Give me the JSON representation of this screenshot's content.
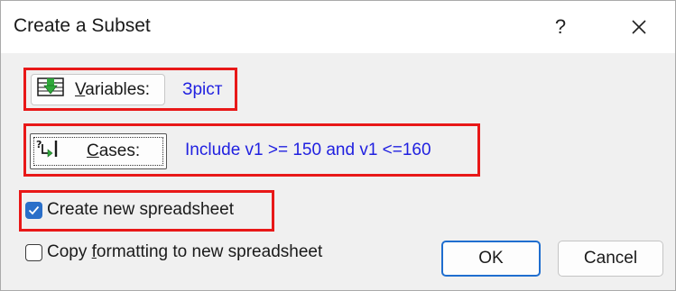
{
  "dialog": {
    "title": "Create a Subset",
    "help_label": "?",
    "close_icon": "close-icon"
  },
  "variables": {
    "label_mnemonic": "V",
    "label_rest": "ariables:",
    "value": "Зріст",
    "icon": "variables-icon"
  },
  "cases": {
    "label_mnemonic": "C",
    "label_rest": "ases:",
    "value": "Include v1 >= 150 and v1 <=160",
    "icon": "cases-icon"
  },
  "options": {
    "new_spreadsheet": {
      "label": "Create new spreadsheet",
      "checked": true
    },
    "copy_formatting": {
      "label_before": "Copy ",
      "label_mnemonic": "f",
      "label_after": "ormatting to new spreadsheet",
      "checked": false
    }
  },
  "buttons": {
    "ok": "OK",
    "cancel": "Cancel"
  },
  "colors": {
    "value_text": "#1f1fe0",
    "highlight": "#e81818",
    "checkbox_on": "#2a6fc9",
    "ok_border": "#1f6ecf"
  }
}
